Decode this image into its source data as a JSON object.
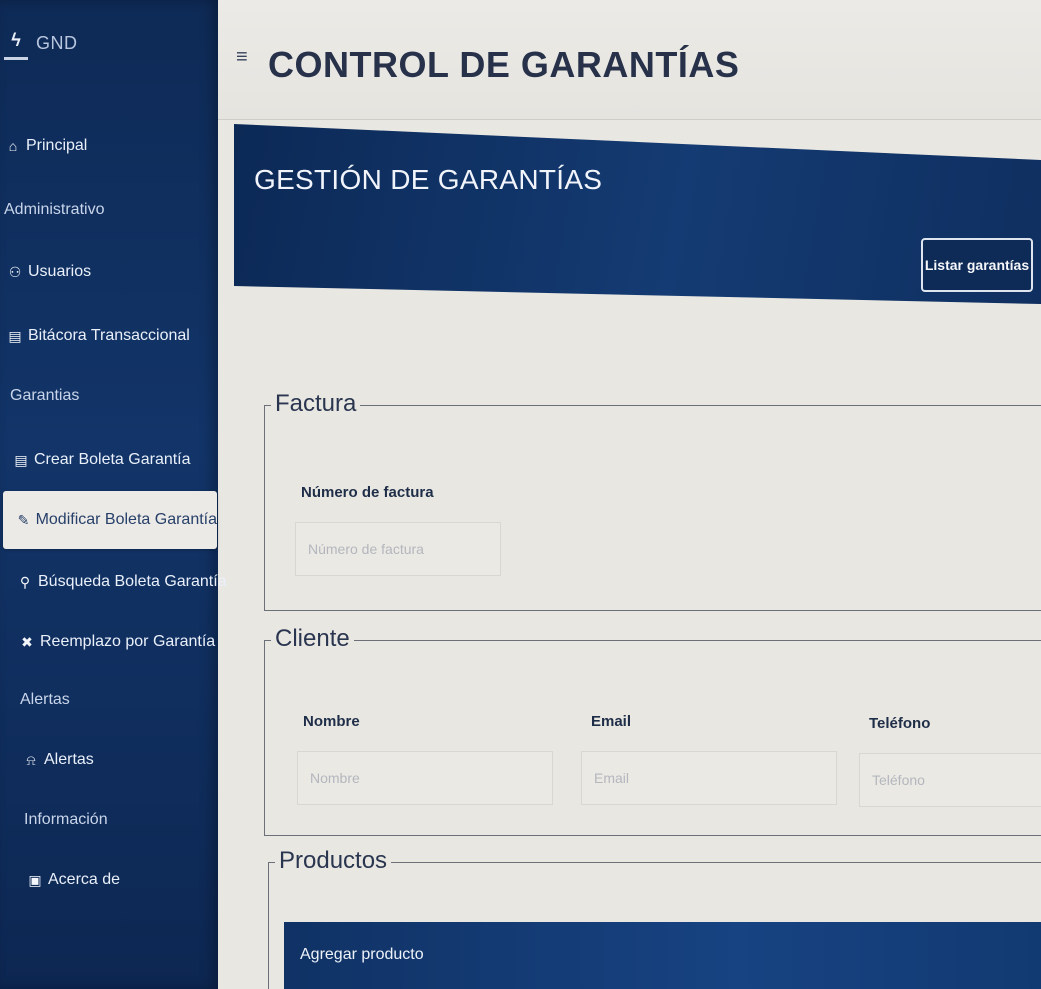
{
  "brand": {
    "logo_glyph": "ϟ",
    "name": "GND"
  },
  "sidebar": {
    "items": [
      {
        "label": "Principal",
        "icon": "home-icon",
        "glyph": "⌂",
        "type": "link"
      },
      {
        "label": "Administrativo",
        "type": "section"
      },
      {
        "label": "Usuarios",
        "icon": "users-icon",
        "glyph": "⚇",
        "type": "link"
      },
      {
        "label": "Bitácora Transaccional",
        "icon": "book-icon",
        "glyph": "▤",
        "type": "link"
      },
      {
        "label": "Garantias",
        "type": "section"
      },
      {
        "label": "Crear Boleta Garantía",
        "icon": "file-icon",
        "glyph": "▤",
        "type": "link"
      },
      {
        "label": "Modificar Boleta Garantía",
        "icon": "edit-icon",
        "glyph": "✎",
        "type": "link",
        "active": true
      },
      {
        "label": "Búsqueda Boleta Garantía",
        "icon": "search-icon",
        "glyph": "⚲",
        "type": "link"
      },
      {
        "label": "Reemplazo por Garantía",
        "icon": "tools-icon",
        "glyph": "✖",
        "type": "link"
      },
      {
        "label": "Alertas",
        "type": "section"
      },
      {
        "label": "Alertas",
        "icon": "bell-icon",
        "glyph": "⍾",
        "type": "link"
      },
      {
        "label": "Información",
        "type": "section"
      },
      {
        "label": "Acerca de",
        "icon": "info-icon",
        "glyph": "▣",
        "type": "link"
      }
    ]
  },
  "header": {
    "menu_glyph": "≡",
    "title": "CONTROL DE GARANTÍAS"
  },
  "banner": {
    "title": "GESTIÓN DE GARANTÍAS",
    "list_button": "Listar garantías"
  },
  "factura": {
    "legend": "Factura",
    "numero_label": "Número de factura",
    "numero_placeholder": "Número de factura"
  },
  "cliente": {
    "legend": "Cliente",
    "nombre_label": "Nombre",
    "nombre_placeholder": "Nombre",
    "email_label": "Email",
    "email_placeholder": "Email",
    "telefono_label": "Teléfono",
    "telefono_placeholder": "Teléfono"
  },
  "productos": {
    "legend": "Productos",
    "add_button": "Agregar producto"
  },
  "colors": {
    "sidebar": "#123468",
    "banner": "#0c2956",
    "background": "#e9e7e2"
  }
}
